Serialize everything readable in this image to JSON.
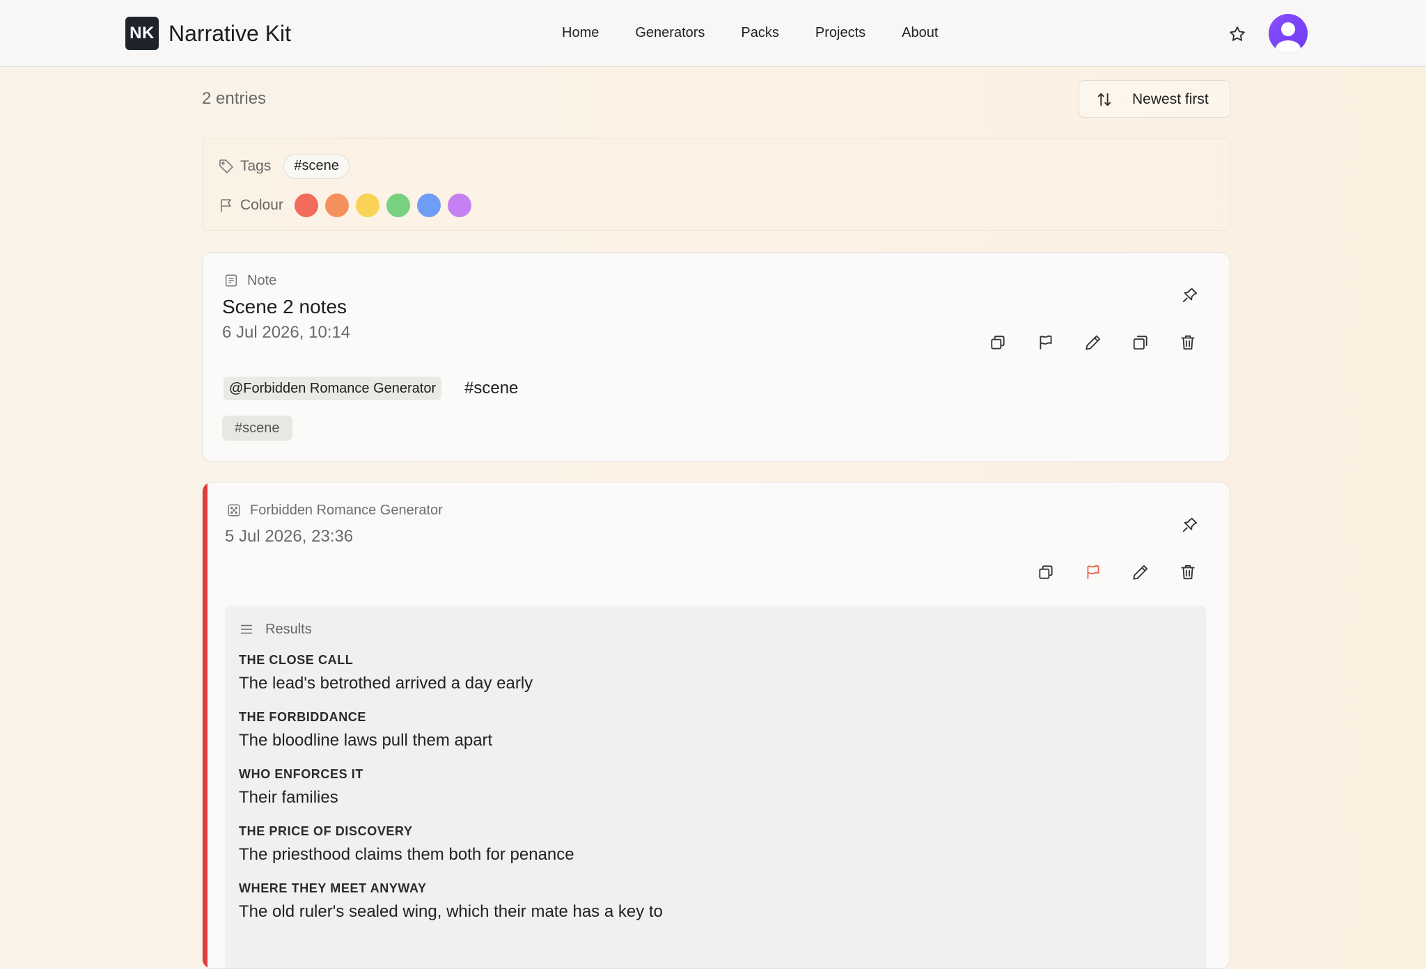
{
  "header": {
    "logo_text": "NK",
    "brand": "Narrative Kit",
    "nav": [
      "Home",
      "Generators",
      "Packs",
      "Projects",
      "About"
    ]
  },
  "toolbar": {
    "entry_count": "2 entries",
    "sort_label": "Newest first"
  },
  "filters": {
    "tags_label": "Tags",
    "tag_chip": "#scene",
    "colour_label": "Colour",
    "swatches": [
      "#f26b5b",
      "#f4905e",
      "#f9d257",
      "#77d17e",
      "#6f9df5",
      "#c581f2"
    ]
  },
  "note_card": {
    "kind": "Note",
    "title": "Scene 2 notes",
    "date": "6 Jul 2026, 10:14",
    "mention": "@Forbidden Romance Generator",
    "inline_tag": "#scene",
    "tag": "#scene"
  },
  "gen_card": {
    "kind": "Forbidden Romance Generator",
    "date": "5 Jul 2026, 23:36",
    "accent_color": "#e63b3b",
    "flag_color": "#e8674a",
    "results_label": "Results",
    "results": [
      {
        "heading": "THE CLOSE CALL",
        "value": "The lead's betrothed arrived a day early"
      },
      {
        "heading": "THE FORBIDDANCE",
        "value": "The bloodline laws pull them apart"
      },
      {
        "heading": "WHO ENFORCES IT",
        "value": "Their families"
      },
      {
        "heading": "THE PRICE OF DISCOVERY",
        "value": "The priesthood claims them both for penance"
      },
      {
        "heading": "WHERE THEY MEET ANYWAY",
        "value": "The old ruler's sealed wing, which their mate has a key to"
      }
    ]
  }
}
